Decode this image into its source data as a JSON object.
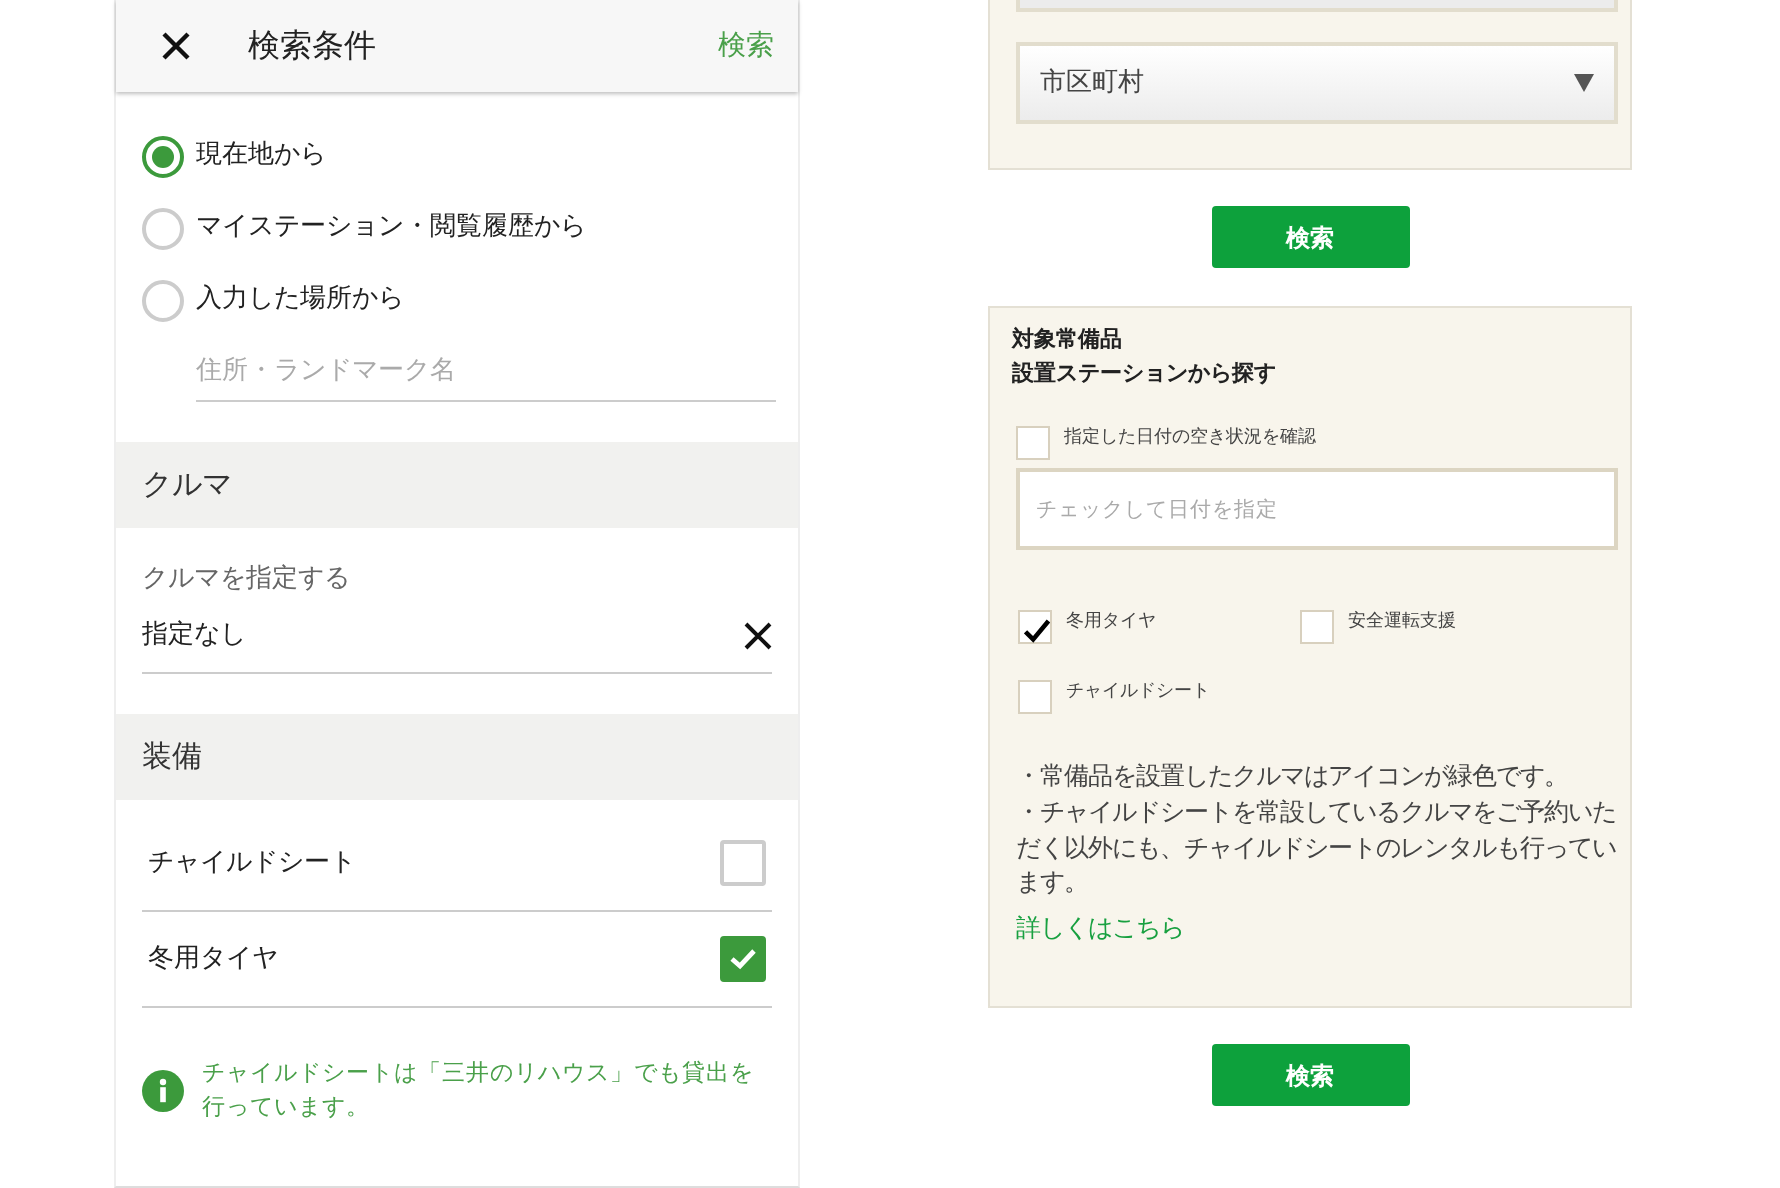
{
  "header": {
    "title": "検索条件",
    "action": "検索"
  },
  "location_options": [
    {
      "label": "現在地から",
      "selected": true
    },
    {
      "label": "マイステーション・閲覧履歴から",
      "selected": false
    },
    {
      "label": "入力した場所から",
      "selected": false
    }
  ],
  "place_field": {
    "placeholder": "住所・ランドマーク名"
  },
  "car_section": {
    "heading": "クルマ",
    "label": "クルマを指定する",
    "value": "指定なし"
  },
  "equipment_section": {
    "heading": "装備",
    "items": [
      {
        "label": "チャイルドシート",
        "checked": false
      },
      {
        "label": "冬用タイヤ",
        "checked": true
      }
    ]
  },
  "notice": "チャイルドシートは「三井のリハウス」でも貸出を行っています。",
  "area_select": {
    "value": "市区町村"
  },
  "area_search_button": "検索",
  "station_search": {
    "title_lines": [
      "対象常備品",
      "設置ステーションから探す"
    ],
    "date_check": {
      "label": "指定した日付の空き状況を確認",
      "checked": false
    },
    "date_field": {
      "placeholder": "チェックして日付を指定"
    },
    "equipment": [
      {
        "label": "冬用タイヤ",
        "checked": true
      },
      {
        "label": "安全運転支援",
        "checked": false
      },
      {
        "label": "チャイルドシート",
        "checked": false
      }
    ],
    "notes": [
      "・常備品を設置したクルマはアイコンが緑色です。",
      "・チャイルドシートを常設しているクルマをご予約いただく以外にも、チャイルドシートのレンタルも行っています。"
    ],
    "link": "詳しくはこちら"
  },
  "station_search_button": "検索"
}
